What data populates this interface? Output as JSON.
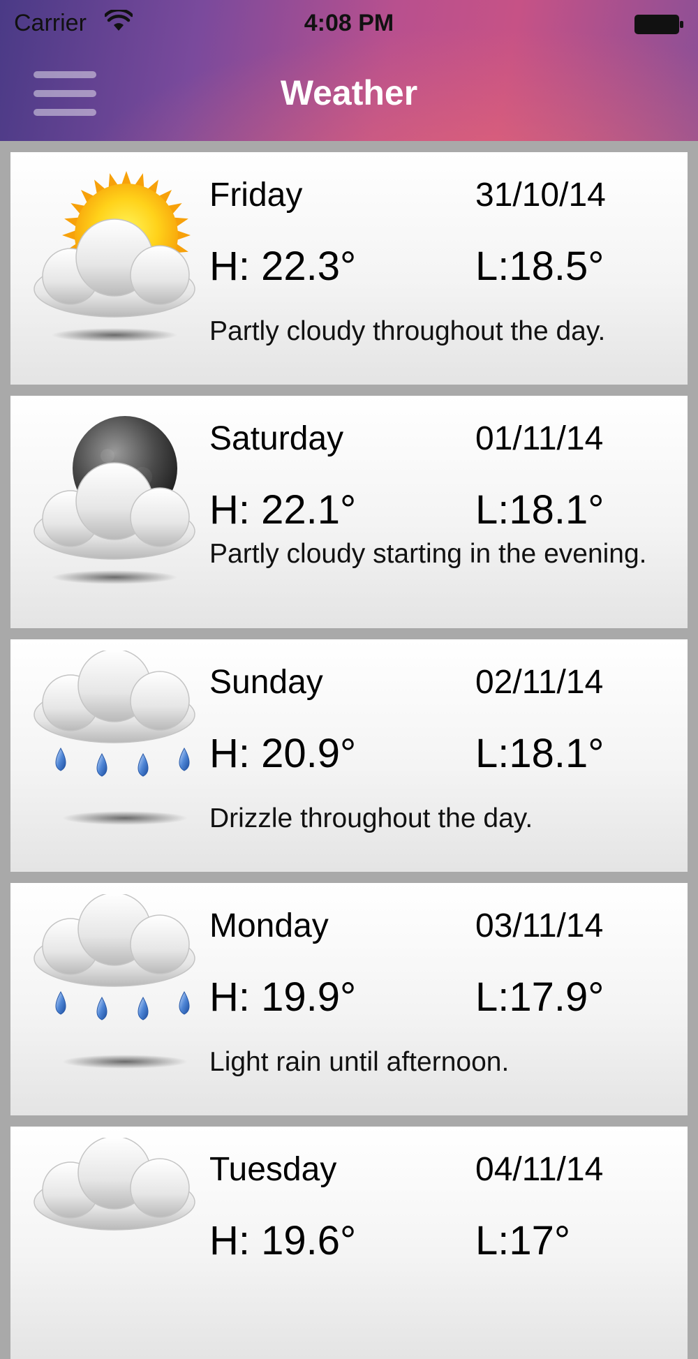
{
  "status_bar": {
    "carrier": "Carrier",
    "time": "4:08 PM",
    "wifi_icon": "wifi-icon",
    "battery_icon": "battery-icon"
  },
  "nav": {
    "title": "Weather",
    "menu_icon": "hamburger-menu-icon"
  },
  "forecast": [
    {
      "day": "Friday",
      "date": "31/10/14",
      "high": "H: 22.3°",
      "low": "L:18.5°",
      "summary": "Partly cloudy throughout the day.",
      "icon": "partly-cloudy-day-icon"
    },
    {
      "day": "Saturday",
      "date": "01/11/14",
      "high": "H: 22.1°",
      "low": "L:18.1°",
      "summary": "Partly cloudy starting in the evening.",
      "icon": "partly-cloudy-night-icon"
    },
    {
      "day": "Sunday",
      "date": "02/11/14",
      "high": "H: 20.9°",
      "low": "L:18.1°",
      "summary": "Drizzle throughout the day.",
      "icon": "rain-icon"
    },
    {
      "day": "Monday",
      "date": "03/11/14",
      "high": "H: 19.9°",
      "low": "L:17.9°",
      "summary": "Light rain until afternoon.",
      "icon": "rain-icon"
    },
    {
      "day": "Tuesday",
      "date": "04/11/14",
      "high": "H: 19.6°",
      "low": "L:17°",
      "summary": "",
      "icon": "cloud-icon"
    }
  ]
}
